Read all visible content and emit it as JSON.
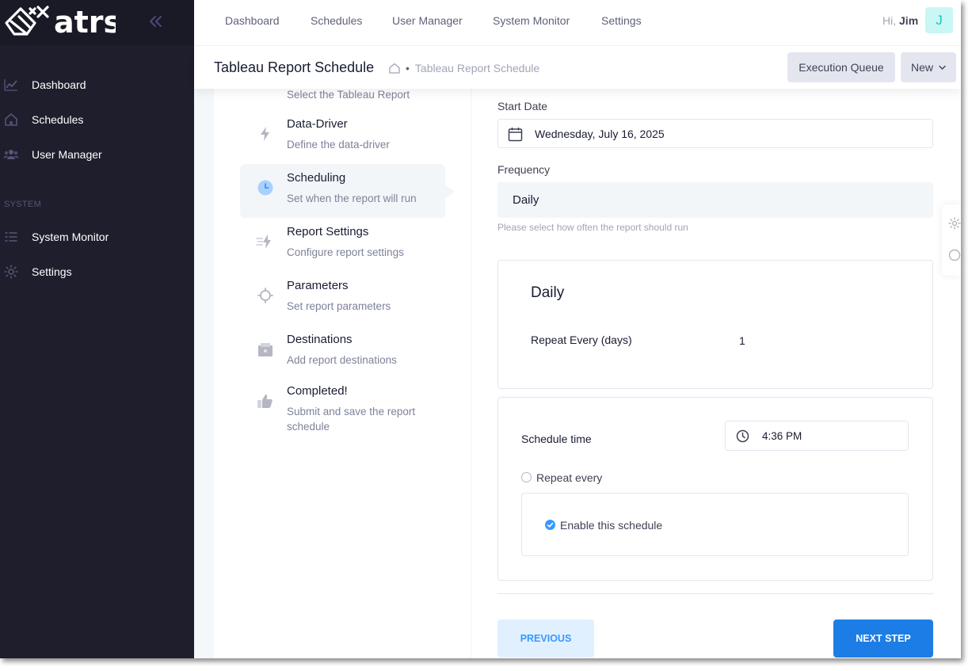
{
  "app": {
    "logo_text": "atrs"
  },
  "sidebar": {
    "items": [
      {
        "label": "Dashboard",
        "icon": "chart-icon"
      },
      {
        "label": "Schedules",
        "icon": "home-icon"
      },
      {
        "label": "User Manager",
        "icon": "users-icon"
      }
    ],
    "section_label": "SYSTEM",
    "system_items": [
      {
        "label": "System Monitor",
        "icon": "list-icon"
      },
      {
        "label": "Settings",
        "icon": "gear-icon"
      }
    ]
  },
  "topnav": {
    "links": [
      "Dashboard",
      "Schedules",
      "User Manager",
      "System Monitor",
      "Settings"
    ],
    "greeting": "Hi,",
    "user_name": "Jim",
    "avatar_initial": "J"
  },
  "toolbar": {
    "title": "Tableau Report Schedule",
    "breadcrumb_separator": "•",
    "breadcrumb_current": "Tableau Report Schedule",
    "queue_label": "Execution Queue",
    "new_label": "New"
  },
  "steps": [
    {
      "title": "",
      "desc": "Select the Tableau Report"
    },
    {
      "title": "Data-Driver",
      "desc": "Define the data-driver"
    },
    {
      "title": "Scheduling",
      "desc": "Set when the report will run"
    },
    {
      "title": "Report Settings",
      "desc": "Configure report settings"
    },
    {
      "title": "Parameters",
      "desc": "Set report parameters"
    },
    {
      "title": "Destinations",
      "desc": "Add report destinations"
    },
    {
      "title": "Completed!",
      "desc": "Submit and save the report schedule"
    }
  ],
  "form": {
    "start_date_label": "Start Date",
    "start_date_value": "Wednesday, July 16, 2025",
    "frequency_label": "Frequency",
    "frequency_value": "Daily",
    "frequency_help": "Please select how often the report should run",
    "daily_title": "Daily",
    "repeat_label": "Repeat Every (days)",
    "repeat_value": "1",
    "schedule_time_label": "Schedule time",
    "schedule_time_value": "4:36 PM",
    "repeat_every_label": "Repeat every",
    "enable_label": "Enable this schedule",
    "enable_checked": true,
    "previous_label": "PREVIOUS",
    "next_label": "NEXT STEP"
  },
  "colors": {
    "sidebar_bg": "#1e1e2d",
    "primary": "#1d7de6",
    "accent_light": "#e1f0ff",
    "avatar_bg": "#c9f7f5"
  }
}
